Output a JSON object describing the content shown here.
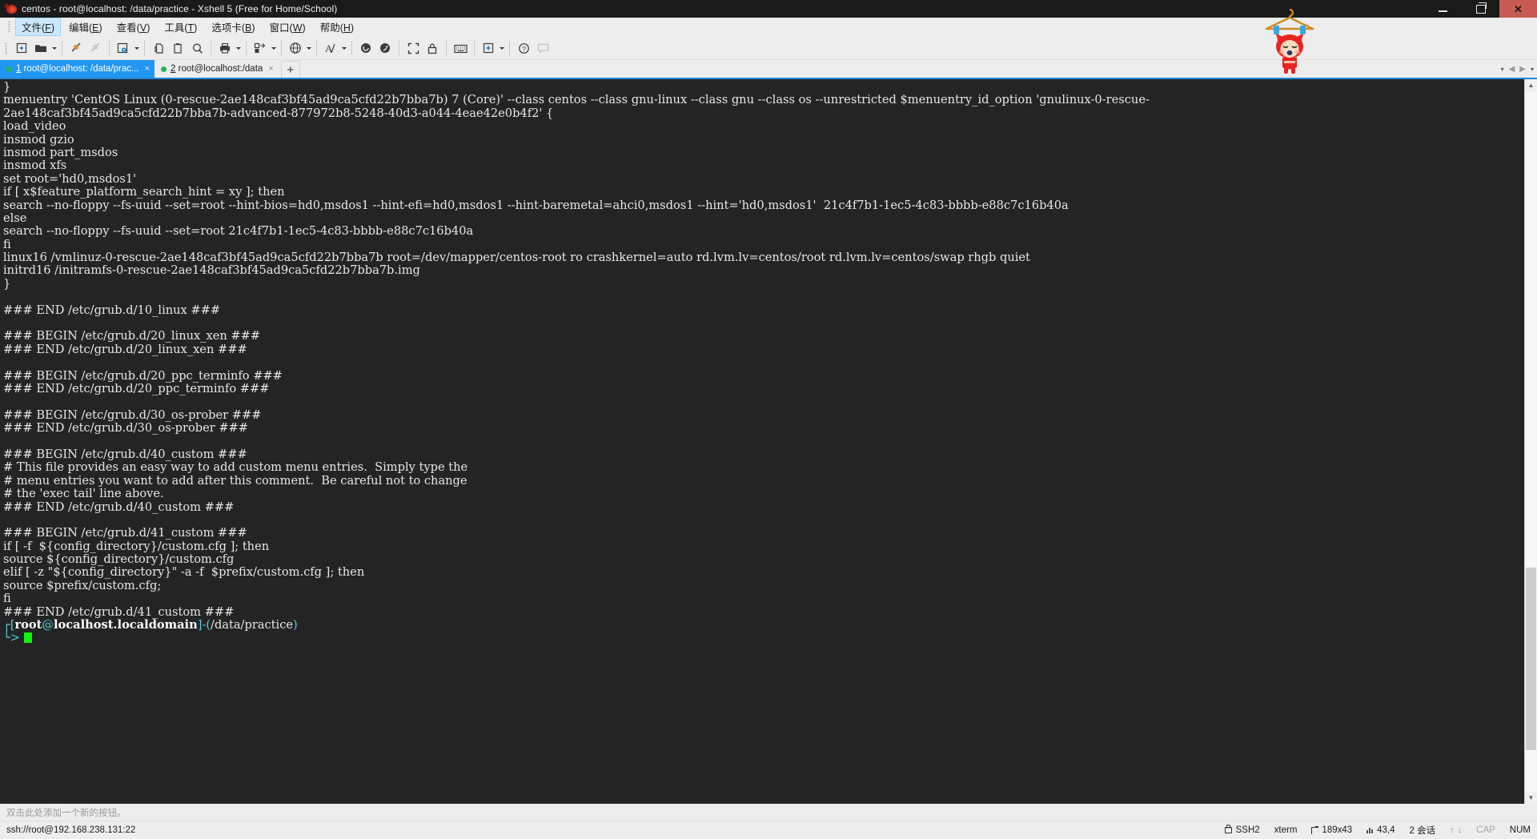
{
  "window": {
    "title": "centos - root@localhost: /data/practice - Xshell 5 (Free for Home/School)",
    "app_icon": "snail-icon",
    "minimize_label": "–",
    "maximize_label": "□",
    "close_label": "✕"
  },
  "menubar": {
    "items": [
      {
        "name": "file",
        "pre": "文件(",
        "key": "F",
        "post": ")"
      },
      {
        "name": "edit",
        "pre": "编辑(",
        "key": "E",
        "post": ")"
      },
      {
        "name": "view",
        "pre": "查看(",
        "key": "V",
        "post": ")"
      },
      {
        "name": "tools",
        "pre": "工具(",
        "key": "T",
        "post": ")"
      },
      {
        "name": "tabs",
        "pre": "选项卡(",
        "key": "B",
        "post": ")"
      },
      {
        "name": "window",
        "pre": "窗口(",
        "key": "W",
        "post": ")"
      },
      {
        "name": "help",
        "pre": "帮助(",
        "key": "H",
        "post": ")"
      }
    ]
  },
  "toolbar": {
    "icons": [
      "new-session-icon",
      "open-folder-icon",
      "dropdown-caret",
      "connect-icon",
      "disconnect-icon",
      "session-properties-icon",
      "dropdown-caret",
      "copy-icon",
      "paste-icon",
      "find-icon",
      "print-icon",
      "dropdown-caret",
      "transfer-icon",
      "dropdown-caret",
      "browser-icon",
      "dropdown-caret",
      "font-icon",
      "dropdown-caret",
      "sftp-icon",
      "ftp-icon",
      "fullscreen-icon",
      "lock-icon",
      "keyboard-icon",
      "add-panel-icon",
      "dropdown-caret",
      "help-icon",
      "comment-icon"
    ]
  },
  "tabs": {
    "items": [
      {
        "num": "1",
        "label": " root@localhost: /data/prac...",
        "active": true,
        "close": "×"
      },
      {
        "num": "2",
        "label": " root@localhost:/data",
        "active": false,
        "close": "×"
      }
    ],
    "new_tab_label": "+",
    "nav_prev": "◀",
    "nav_next": "▶",
    "overflow": "▾"
  },
  "terminal": {
    "lines": [
      {
        "segs": [
          {
            "t": "}",
            "c": "wht"
          }
        ]
      },
      {
        "segs": [
          {
            "t": "menuentry 'CentOS Linux (0-rescue-2ae148caf3bf45ad9ca5cfd22b7bba7b) 7 (Core)' --class centos --class gnu-linux --class gnu --class os --unrestricted $menuentry_id_option 'gnulinux-0-rescue-",
            "c": "wht"
          }
        ]
      },
      {
        "segs": [
          {
            "t": "2ae148caf3bf45ad9ca5cfd22b7bba7b-advanced-877972b8-5248-40d3-a044-4eae42e0b4f2' {",
            "c": "wht"
          }
        ]
      },
      {
        "segs": [
          {
            "t": "load_video",
            "c": "wht"
          }
        ]
      },
      {
        "segs": [
          {
            "t": "insmod gzio",
            "c": "wht"
          }
        ]
      },
      {
        "segs": [
          {
            "t": "insmod part_msdos",
            "c": "wht"
          }
        ]
      },
      {
        "segs": [
          {
            "t": "insmod xfs",
            "c": "wht"
          }
        ]
      },
      {
        "segs": [
          {
            "t": "set root='hd0,msdos1'",
            "c": "wht"
          }
        ]
      },
      {
        "segs": [
          {
            "t": "if [ x$feature_platform_search_hint = xy ]; then",
            "c": "wht"
          }
        ]
      },
      {
        "segs": [
          {
            "t": "search --no-floppy --fs-uuid --set=root --hint-bios=hd0,msdos1 --hint-efi=hd0,msdos1 --hint-baremetal=ahci0,msdos1 --hint='hd0,msdos1'  21c4f7b1-1ec5-4c83-bbbb-e88c7c16b40a",
            "c": "wht"
          }
        ]
      },
      {
        "segs": [
          {
            "t": "else",
            "c": "wht"
          }
        ]
      },
      {
        "segs": [
          {
            "t": "search --no-floppy --fs-uuid --set=root 21c4f7b1-1ec5-4c83-bbbb-e88c7c16b40a",
            "c": "wht"
          }
        ]
      },
      {
        "segs": [
          {
            "t": "fi",
            "c": "wht"
          }
        ]
      },
      {
        "segs": [
          {
            "t": "linux16 /vmlinuz-0-rescue-2ae148caf3bf45ad9ca5cfd22b7bba7b root=/dev/mapper/centos-root ro crashkernel=auto rd.lvm.lv=centos/root rd.lvm.lv=centos/swap rhgb quiet",
            "c": "wht"
          }
        ]
      },
      {
        "segs": [
          {
            "t": "initrd16 /initramfs-0-rescue-2ae148caf3bf45ad9ca5cfd22b7bba7b.img",
            "c": "wht"
          }
        ]
      },
      {
        "segs": [
          {
            "t": "}",
            "c": "wht"
          }
        ]
      },
      {
        "segs": [
          {
            "t": "",
            "c": "wht"
          }
        ]
      },
      {
        "segs": [
          {
            "t": "### END /etc/grub.d/10_linux ###",
            "c": "wht"
          }
        ]
      },
      {
        "segs": [
          {
            "t": "",
            "c": "wht"
          }
        ]
      },
      {
        "segs": [
          {
            "t": "### BEGIN /etc/grub.d/20_linux_xen ###",
            "c": "wht"
          }
        ]
      },
      {
        "segs": [
          {
            "t": "### END /etc/grub.d/20_linux_xen ###",
            "c": "wht"
          }
        ]
      },
      {
        "segs": [
          {
            "t": "",
            "c": "wht"
          }
        ]
      },
      {
        "segs": [
          {
            "t": "### BEGIN /etc/grub.d/20_ppc_terminfo ###",
            "c": "wht"
          }
        ]
      },
      {
        "segs": [
          {
            "t": "### END /etc/grub.d/20_ppc_terminfo ###",
            "c": "wht"
          }
        ]
      },
      {
        "segs": [
          {
            "t": "",
            "c": "wht"
          }
        ]
      },
      {
        "segs": [
          {
            "t": "### BEGIN /etc/grub.d/30_os-prober ###",
            "c": "wht"
          }
        ]
      },
      {
        "segs": [
          {
            "t": "### END /etc/grub.d/30_os-prober ###",
            "c": "wht"
          }
        ]
      },
      {
        "segs": [
          {
            "t": "",
            "c": "wht"
          }
        ]
      },
      {
        "segs": [
          {
            "t": "### BEGIN /etc/grub.d/40_custom ###",
            "c": "wht"
          }
        ]
      },
      {
        "segs": [
          {
            "t": "# This file provides an easy way to add custom menu entries.  Simply type the",
            "c": "wht"
          }
        ]
      },
      {
        "segs": [
          {
            "t": "# menu entries you want to add after this comment.  Be careful not to change",
            "c": "wht"
          }
        ]
      },
      {
        "segs": [
          {
            "t": "# the 'exec tail' line above.",
            "c": "wht"
          }
        ]
      },
      {
        "segs": [
          {
            "t": "### END /etc/grub.d/40_custom ###",
            "c": "wht"
          }
        ]
      },
      {
        "segs": [
          {
            "t": "",
            "c": "wht"
          }
        ]
      },
      {
        "segs": [
          {
            "t": "### BEGIN /etc/grub.d/41_custom ###",
            "c": "wht"
          }
        ]
      },
      {
        "segs": [
          {
            "t": "if [ -f  ${config_directory}/custom.cfg ]; then",
            "c": "wht"
          }
        ]
      },
      {
        "segs": [
          {
            "t": "source ${config_directory}/custom.cfg",
            "c": "wht"
          }
        ]
      },
      {
        "segs": [
          {
            "t": "elif [ -z \"${config_directory}\" -a -f  $prefix/custom.cfg ]; then",
            "c": "wht"
          }
        ]
      },
      {
        "segs": [
          {
            "t": "source $prefix/custom.cfg;",
            "c": "wht"
          }
        ]
      },
      {
        "segs": [
          {
            "t": "fi",
            "c": "wht"
          }
        ]
      },
      {
        "segs": [
          {
            "t": "### END /etc/grub.d/41_custom ###",
            "c": "wht"
          }
        ]
      }
    ],
    "prompt": {
      "bracket_open": "┌[",
      "user": "root",
      "at": "@",
      "host": "localhost.localdomain",
      "bracket_close": "]",
      "dash": "-",
      "paren_open": "(",
      "path": "/data/practice",
      "paren_close": ")",
      "line2": "└> "
    }
  },
  "quickbar": {
    "hint": "双击此处添加一个新的按钮。"
  },
  "statusbar": {
    "connection": "ssh://root@192.168.238.131:22",
    "protocol": "SSH2",
    "term_type": "xterm",
    "dimensions": "189x43",
    "cursor_pos": "43,4",
    "sessions": "2 会话",
    "cap": "CAP",
    "num": "NUM"
  },
  "colors": {
    "accent": "#2196f3",
    "terminal_bg": "#242424",
    "terminal_fg": "#d8d8d8",
    "prompt_cyan": "#4fd2dd",
    "cursor_green": "#12f312",
    "close_red": "#c75b53",
    "chrome": "#ededed"
  }
}
